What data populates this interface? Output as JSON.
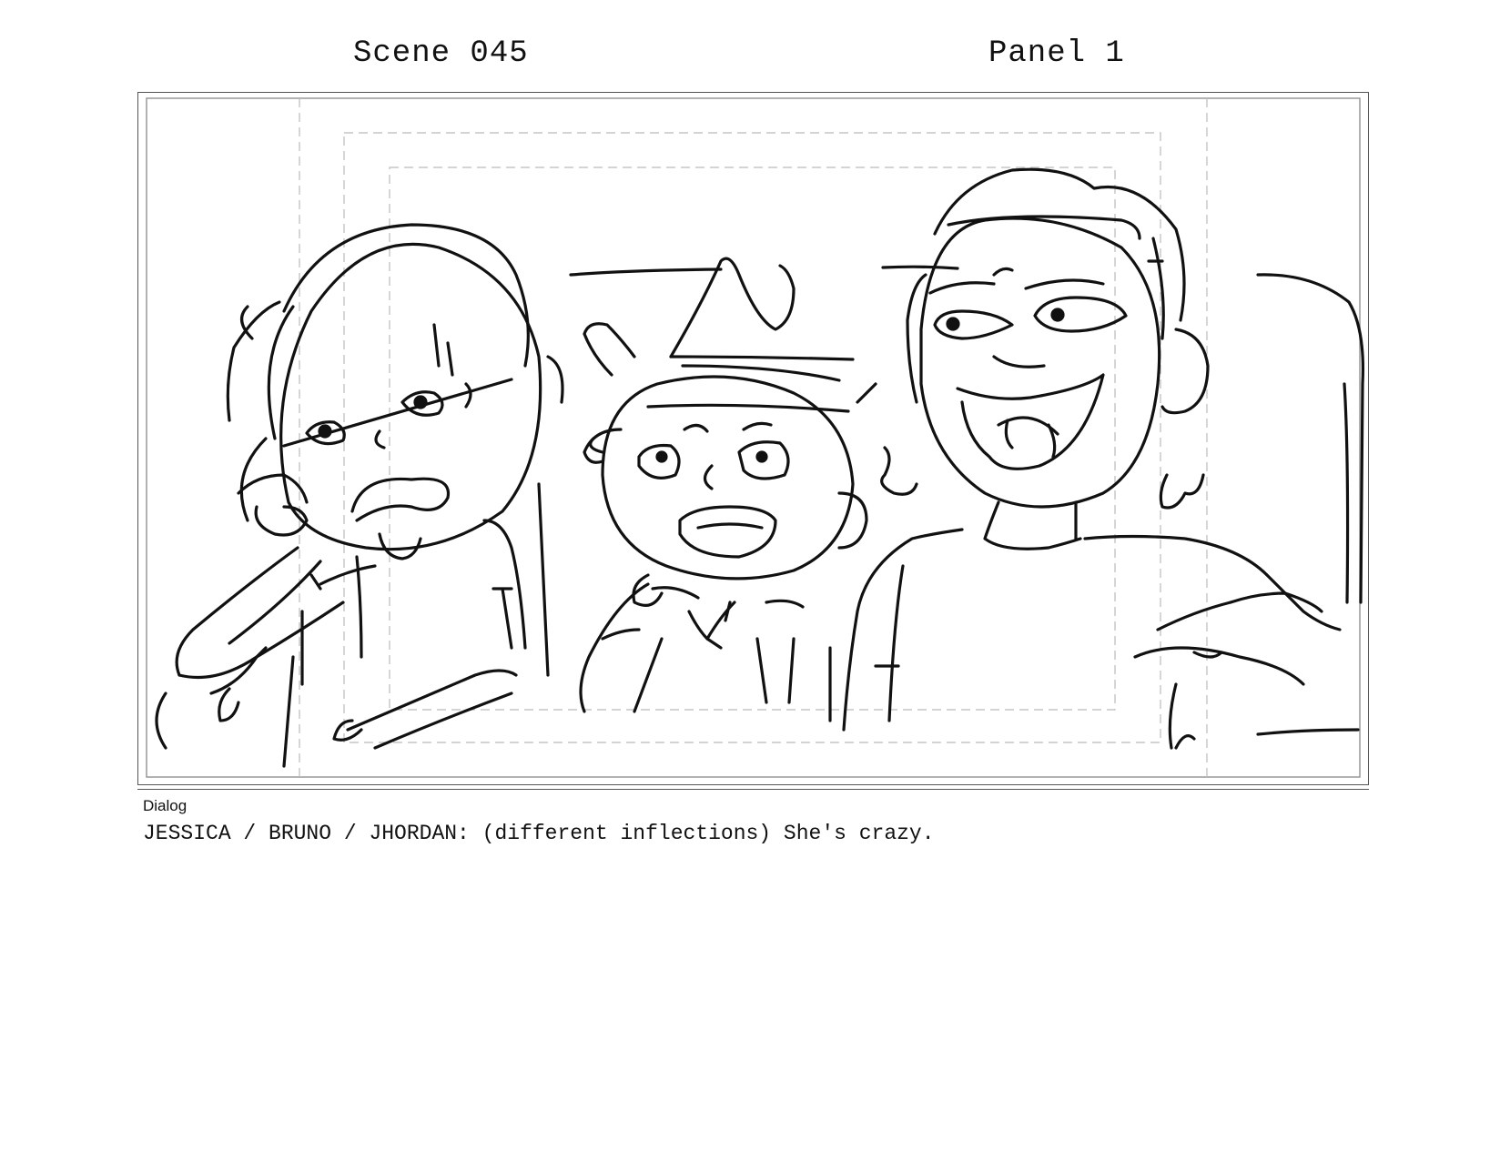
{
  "header": {
    "scene": "Scene 045",
    "panel": "Panel 1"
  },
  "panel_image": {
    "icon": "storyboard-sketch-three-characters",
    "line_color": "#111111",
    "guide_color": "#bbbbbb"
  },
  "dialog": {
    "label": "Dialog",
    "text": "JESSICA / BRUNO / JHORDAN: (different inflections) She's crazy."
  }
}
